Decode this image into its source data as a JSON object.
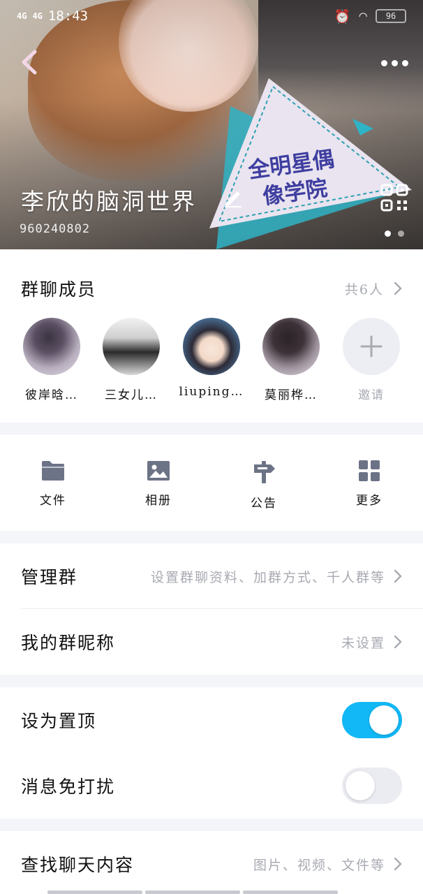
{
  "status_bar": {
    "signal1": "4G",
    "signal2": "4G",
    "time": "18:43",
    "battery": "96"
  },
  "header": {
    "group_name": "李欣的脑洞世界",
    "group_id": "960240802",
    "badge_line1": "全明星偶",
    "badge_line2": "像学院"
  },
  "members": {
    "title": "群聊成员",
    "count": "共6人",
    "list": [
      {
        "name": "彼岸晗…"
      },
      {
        "name": "三女儿…"
      },
      {
        "name": "liuping…"
      },
      {
        "name": "莫丽桦…"
      }
    ],
    "invite_label": "邀请"
  },
  "tools": [
    {
      "label": "文件",
      "icon": "folder-icon"
    },
    {
      "label": "相册",
      "icon": "image-icon"
    },
    {
      "label": "公告",
      "icon": "signpost-icon"
    },
    {
      "label": "更多",
      "icon": "grid-icon"
    }
  ],
  "manage": {
    "label": "管理群",
    "hint": "设置群聊资料、加群方式、千人群等"
  },
  "nickname": {
    "label": "我的群昵称",
    "value": "未设置"
  },
  "pin": {
    "label": "设为置顶",
    "enabled": true
  },
  "mute": {
    "label": "消息免打扰",
    "enabled": false
  },
  "search": {
    "label": "查找聊天内容",
    "hint": "图片、视频、文件等"
  },
  "colors": {
    "accent": "#12b7f5",
    "icon_gray": "#6d7386",
    "hint_gray": "#a8aab2",
    "badge_teal": "#2fb3c6",
    "badge_text": "#3f3ea0"
  }
}
